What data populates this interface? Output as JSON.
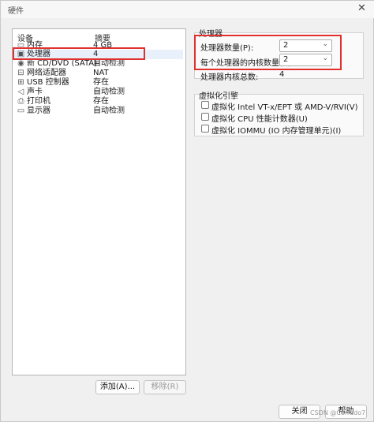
{
  "window": {
    "title": "硬件",
    "close_glyph": "✕"
  },
  "devices": {
    "col_device": "设备",
    "col_summary": "摘要",
    "items": [
      {
        "name": "内存",
        "summary": "4 GB",
        "icon": "memory-icon",
        "glyph": "▭"
      },
      {
        "name": "处理器",
        "summary": "4",
        "icon": "processor-icon",
        "glyph": "▣"
      },
      {
        "name": "新 CD/DVD (SATA)",
        "summary": "自动检测",
        "icon": "cd-dvd-icon",
        "glyph": "◉"
      },
      {
        "name": "网络适配器",
        "summary": "NAT",
        "icon": "network-adapter-icon",
        "glyph": "⊟"
      },
      {
        "name": "USB 控制器",
        "summary": "存在",
        "icon": "usb-controller-icon",
        "glyph": "⊞"
      },
      {
        "name": "声卡",
        "summary": "自动检测",
        "icon": "sound-card-icon",
        "glyph": "◁"
      },
      {
        "name": "打印机",
        "summary": "存在",
        "icon": "printer-icon",
        "glyph": "⎙"
      },
      {
        "name": "显示器",
        "summary": "自动检测",
        "icon": "display-icon",
        "glyph": "▭"
      }
    ],
    "selected_index": 1,
    "add_button": "添加(A)...",
    "remove_button": "移除(R)"
  },
  "processor": {
    "group_title": "处理器",
    "count_label": "处理器数量(P):",
    "count_value": "2",
    "cores_label": "每个处理器的内核数量(C):",
    "cores_value": "2",
    "total_label": "处理器内核总数:",
    "total_value": "4"
  },
  "virtualization": {
    "group_title": "虚拟化引擎",
    "options": [
      {
        "label": "虚拟化 Intel VT-x/EPT 或 AMD-V/RVI(V)",
        "checked": false
      },
      {
        "label": "虚拟化 CPU 性能计数器(U)",
        "checked": false
      },
      {
        "label": "虚拟化 IOMMU (IO 内存管理单元)(I)",
        "checked": false
      }
    ]
  },
  "footer": {
    "close_button": "关闭",
    "help_button": "帮助"
  },
  "watermark": "CSDN @Corrado7",
  "colors": {
    "highlight_border": "#e0312f",
    "selection": "#e8f0fb"
  }
}
